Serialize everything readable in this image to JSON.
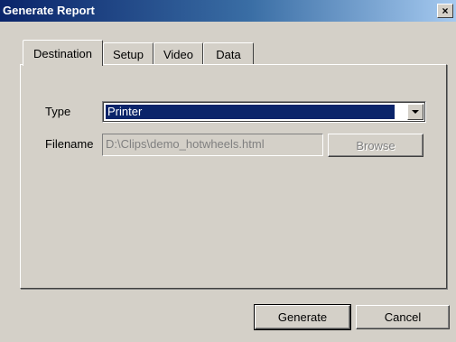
{
  "window": {
    "title": "Generate Report",
    "close_glyph": "×"
  },
  "tabs": [
    {
      "label": "Destination",
      "active": true
    },
    {
      "label": "Setup",
      "active": false
    },
    {
      "label": "Video",
      "active": false
    },
    {
      "label": "Data",
      "active": false
    }
  ],
  "destination": {
    "type_label": "Type",
    "type_value": "Printer",
    "filename_label": "Filename",
    "filename_value": "D:\\Clips\\demo_hotwheels.html",
    "browse_label": "Browse"
  },
  "footer": {
    "generate_label": "Generate",
    "cancel_label": "Cancel"
  },
  "icons": {
    "dropdown": "chevron-down-icon",
    "close": "close-icon"
  },
  "colors": {
    "titlebar_start": "#0a246a",
    "titlebar_end": "#a6caf0",
    "face": "#d4d0c8",
    "selection": "#0a246a"
  }
}
